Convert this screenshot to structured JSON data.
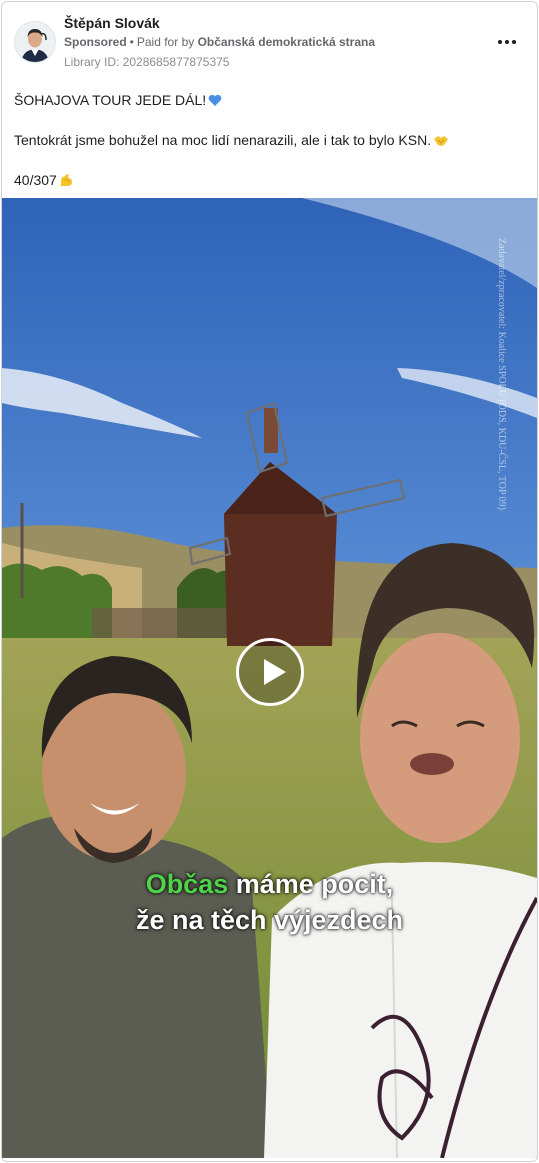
{
  "post": {
    "author": "Štěpán Slovák",
    "sponsored": "Sponsored",
    "paid_for_prefix": "Paid for by",
    "paid_for_by": "Občanská demokratická strana",
    "library_id": "Library ID: 2028685877875375",
    "text_line1": "ŠOHAJOVA TOUR JEDE DÁL!",
    "text_line2": "Tentokrát jsme bohužel na moc lidí nenarazili, ale i tak to bylo KSN.",
    "text_line3": "40/307"
  },
  "video": {
    "caption_highlight": "Občas",
    "caption_rest": "máme pocit,",
    "caption_line2": "že na těch výjezdech",
    "watermark": "Koalice SPOLU (ODS, KDU-ČSL, TOP 09)",
    "watermark_prefix": "Zadavatel/zpracovatel:"
  },
  "icons": {
    "more": "more-dots-icon",
    "play": "play-icon",
    "blue_heart": "blue-heart-emoji",
    "handshake": "handshake-emoji",
    "flex": "flexed-biceps-emoji"
  },
  "colors": {
    "caption_highlight": "#4fd34a",
    "text": "#1c1e21",
    "muted": "#65676b"
  }
}
